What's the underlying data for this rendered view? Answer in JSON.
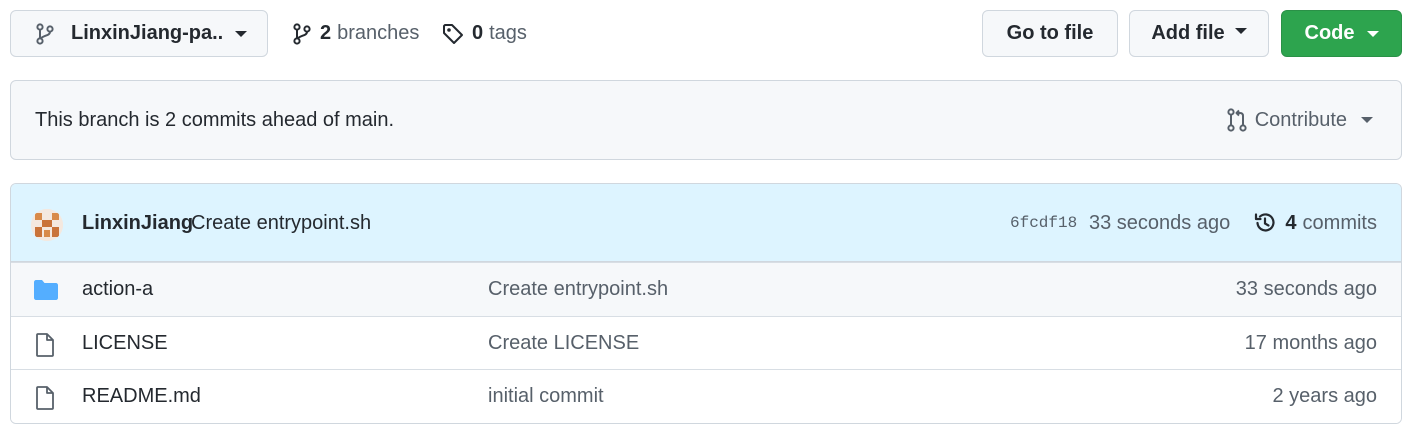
{
  "toolbar": {
    "branch_name": "LinxinJiang-pa...",
    "branches_count": "2",
    "branches_label": "branches",
    "tags_count": "0",
    "tags_label": "tags",
    "goto_file_label": "Go to file",
    "add_file_label": "Add file",
    "code_label": "Code"
  },
  "notice": {
    "message": "This branch is 2 commits ahead of main.",
    "contribute_label": "Contribute"
  },
  "latest_commit": {
    "author": "LinxinJiang",
    "message": "Create entrypoint.sh",
    "sha": "6fcdf18",
    "time": "33 seconds ago",
    "commits_count": "4",
    "commits_label": "commits"
  },
  "files": [
    {
      "icon": "folder-icon",
      "name": "action-a",
      "message": "Create entrypoint.sh",
      "age": "33 seconds ago"
    },
    {
      "icon": "file-icon",
      "name": "LICENSE",
      "message": "Create LICENSE",
      "age": "17 months ago"
    },
    {
      "icon": "file-icon",
      "name": "README.md",
      "message": "initial commit",
      "age": "2 years ago"
    }
  ],
  "colors": {
    "accent_green": "#2da44e",
    "header_blue": "#ddf4ff",
    "folder_blue": "#54aeff",
    "border": "#d0d7de",
    "muted_text": "#57606a"
  }
}
